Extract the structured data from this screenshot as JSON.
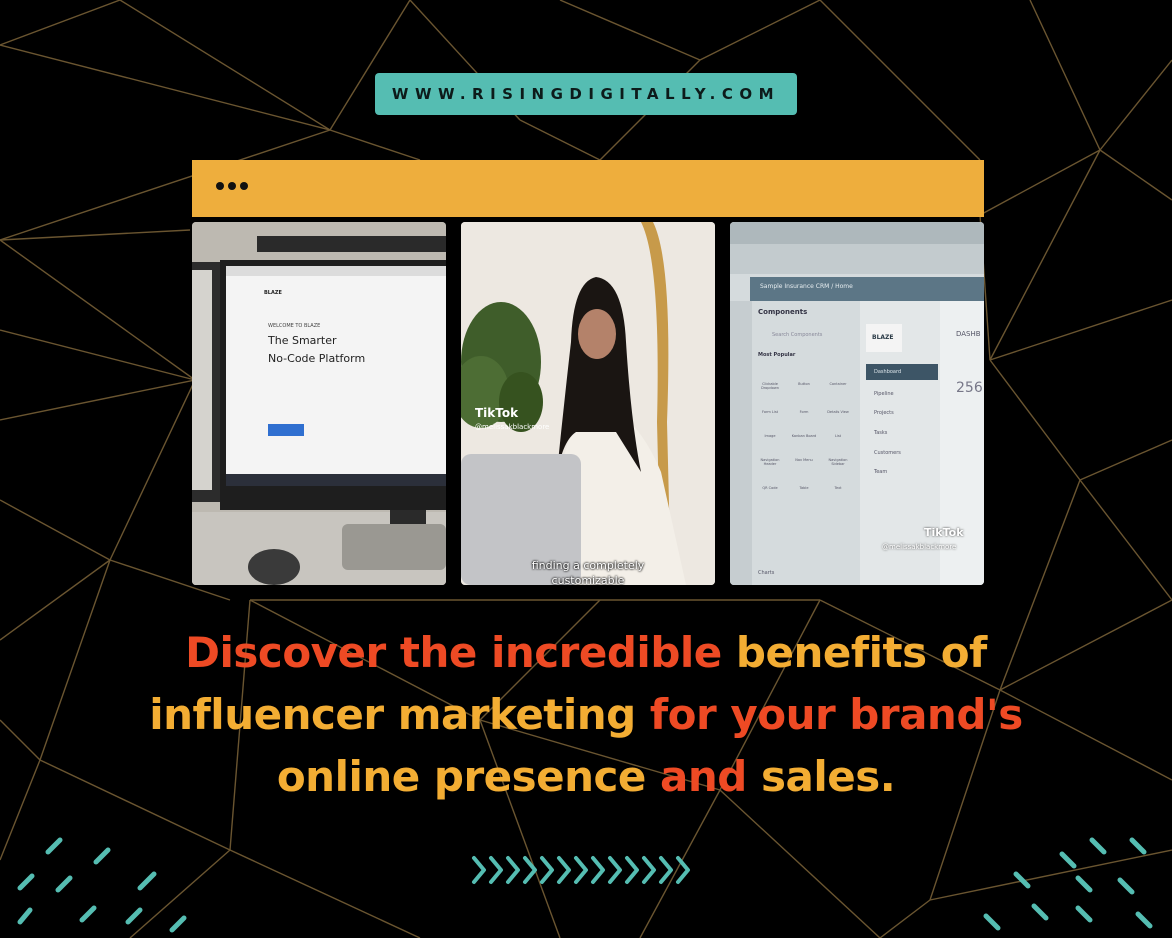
{
  "header": {
    "url": "WWW.RISINGDIGITALLY.COM"
  },
  "colors": {
    "teal": "#55bdb2",
    "gold": "#eeae3d",
    "orange": "#ee4a24",
    "background": "#000000",
    "lines": "#6a5530"
  },
  "browser": {
    "menu_icon": "ellipsis-icon"
  },
  "panels": [
    {
      "screen_small_caps": "WELCOME TO BLAZE",
      "screen_title_1": "The Smarter",
      "screen_title_2": "No-Code Platform",
      "brand": "BLAZE"
    },
    {
      "tiktok_label": "TikTok",
      "handle": "@melissakblackmore",
      "caption_line_1": "finding a completely",
      "caption_line_2": "customizable"
    },
    {
      "app_title": "Sample Insurance CRM / Home",
      "components_label": "Components",
      "search_placeholder": "Search Components",
      "most_popular": "Most Popular",
      "brand": "BLAZE",
      "dashboard_label": "DASHB",
      "nav": [
        "Dashboard",
        "Pipeline",
        "Projects",
        "Tasks",
        "Customers",
        "Team"
      ],
      "components": [
        "Clickable Dropdown",
        "Button",
        "Container",
        "Form List",
        "Form",
        "Details View",
        "Image",
        "Kanban Board",
        "List",
        "Navigation Header",
        "Nav Menu",
        "Navigation Sidebar",
        "QR Code",
        "Table",
        "Text"
      ],
      "charts_label": "Charts",
      "tiktok_label": "TikTok",
      "handle": "@melissakblackmore",
      "partial_value": "256"
    }
  ],
  "headline": {
    "part1": "Discover the incredible",
    "part2": "benefits of",
    "part3": "influencer marketing",
    "part4": "for your brand's",
    "part5": "online presence",
    "part6": "and",
    "part7": "sales."
  }
}
